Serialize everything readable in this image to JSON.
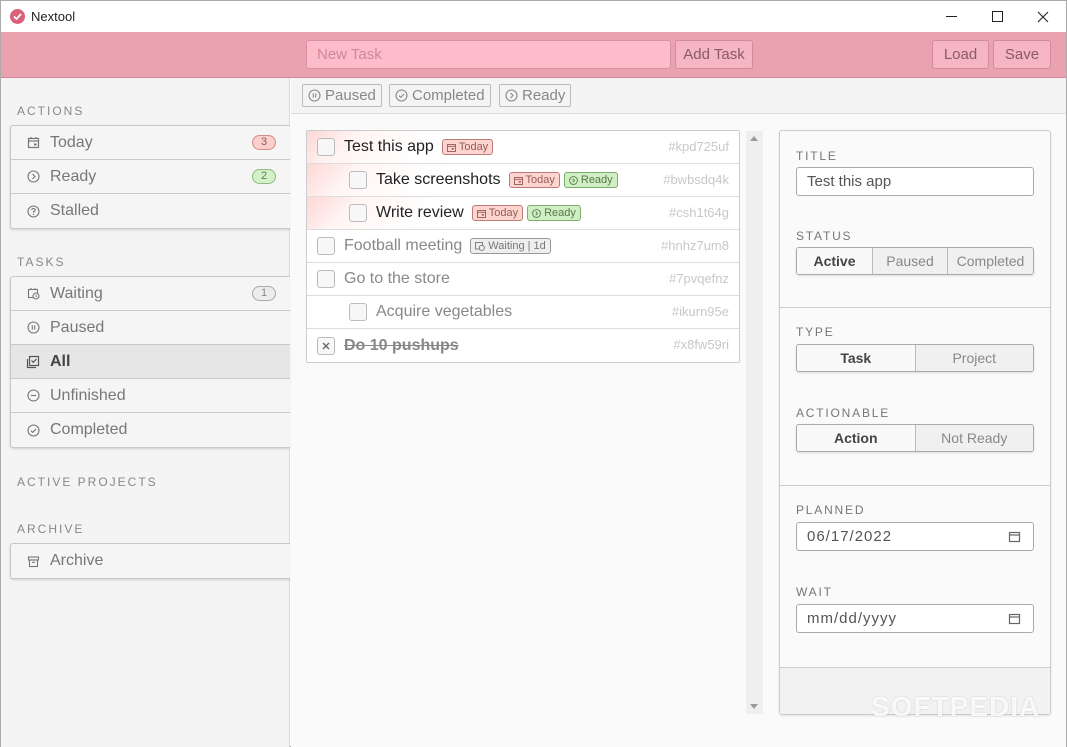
{
  "window": {
    "title": "Nextool",
    "logo_icon": "check-circle-icon",
    "controls": {
      "minimize": "minimize-icon",
      "maximize": "maximize-icon",
      "close": "close-icon"
    }
  },
  "toolbar": {
    "new_task_placeholder": "New Task",
    "new_task_value": "",
    "add_task_label": "Add Task",
    "load_label": "Load",
    "save_label": "Save",
    "accent_color": "#eba2b0"
  },
  "sidebar": {
    "actions_label": "ACTIONS",
    "actions": [
      {
        "label": "Today",
        "icon": "calendar-icon",
        "badge": "3",
        "badge_color": "red"
      },
      {
        "label": "Ready",
        "icon": "chevron-circle-right-icon",
        "badge": "2",
        "badge_color": "green"
      },
      {
        "label": "Stalled",
        "icon": "question-circle-icon",
        "badge": null
      }
    ],
    "tasks_label": "TASKS",
    "tasks": [
      {
        "label": "Waiting",
        "icon": "calendar-clock-icon",
        "badge": "1",
        "badge_color": "gray"
      },
      {
        "label": "Paused",
        "icon": "pause-circle-icon",
        "badge": null
      },
      {
        "label": "All",
        "icon": "checklist-icon",
        "badge": null,
        "active": true
      },
      {
        "label": "Unfinished",
        "icon": "minus-circle-icon",
        "badge": null
      },
      {
        "label": "Completed",
        "icon": "check-circle-icon",
        "badge": null
      }
    ],
    "projects_label": "ACTIVE PROJECTS",
    "archive_label": "ARCHIVE",
    "archive": [
      {
        "label": "Archive",
        "icon": "archive-icon"
      }
    ]
  },
  "filters": [
    {
      "label": "Paused",
      "icon": "pause-circle-icon"
    },
    {
      "label": "Completed",
      "icon": "check-circle-icon"
    },
    {
      "label": "Ready",
      "icon": "chevron-circle-right-icon"
    }
  ],
  "tasks": [
    {
      "title": "Test this app",
      "id": "#kpd725uf",
      "level": 0,
      "today": true,
      "style": "dark",
      "checked": false,
      "tags": [
        {
          "type": "today",
          "label": "Today"
        }
      ]
    },
    {
      "title": "Take screenshots",
      "id": "#bwbsdq4k",
      "level": 1,
      "today": true,
      "style": "dark",
      "checked": false,
      "tags": [
        {
          "type": "today",
          "label": "Today"
        },
        {
          "type": "ready",
          "label": "Ready"
        }
      ]
    },
    {
      "title": "Write review",
      "id": "#csh1t64g",
      "level": 1,
      "today": true,
      "style": "dark",
      "checked": false,
      "tags": [
        {
          "type": "today",
          "label": "Today"
        },
        {
          "type": "ready",
          "label": "Ready"
        }
      ]
    },
    {
      "title": "Football meeting",
      "id": "#hnhz7um8",
      "level": 0,
      "today": false,
      "style": "muted",
      "checked": false,
      "tags": [
        {
          "type": "waiting",
          "label": "Waiting | 1d"
        }
      ]
    },
    {
      "title": "Go to the store",
      "id": "#7pvqefnz",
      "level": 0,
      "today": false,
      "style": "muted",
      "checked": false,
      "tags": []
    },
    {
      "title": "Acquire vegetables",
      "id": "#ikurn95e",
      "level": 1,
      "today": false,
      "style": "muted",
      "checked": false,
      "tags": []
    },
    {
      "title": "Do 10 pushups",
      "id": "#x8fw59ri",
      "level": 0,
      "today": false,
      "style": "done",
      "checked": true,
      "tags": []
    }
  ],
  "detail": {
    "title_label": "TITLE",
    "title_value": "Test this app",
    "status_label": "STATUS",
    "status_options": [
      "Active",
      "Paused",
      "Completed"
    ],
    "status_selected": "Active",
    "type_label": "TYPE",
    "type_options": [
      "Task",
      "Project"
    ],
    "type_selected": "Task",
    "actionable_label": "ACTIONABLE",
    "actionable_options": [
      "Action",
      "Not Ready"
    ],
    "actionable_selected": "Action",
    "planned_label": "PLANNED",
    "planned_value": "06/17/2022",
    "wait_label": "WAIT",
    "wait_value": "mm/dd/yyyy"
  },
  "watermark": "SOFTPEDIA"
}
